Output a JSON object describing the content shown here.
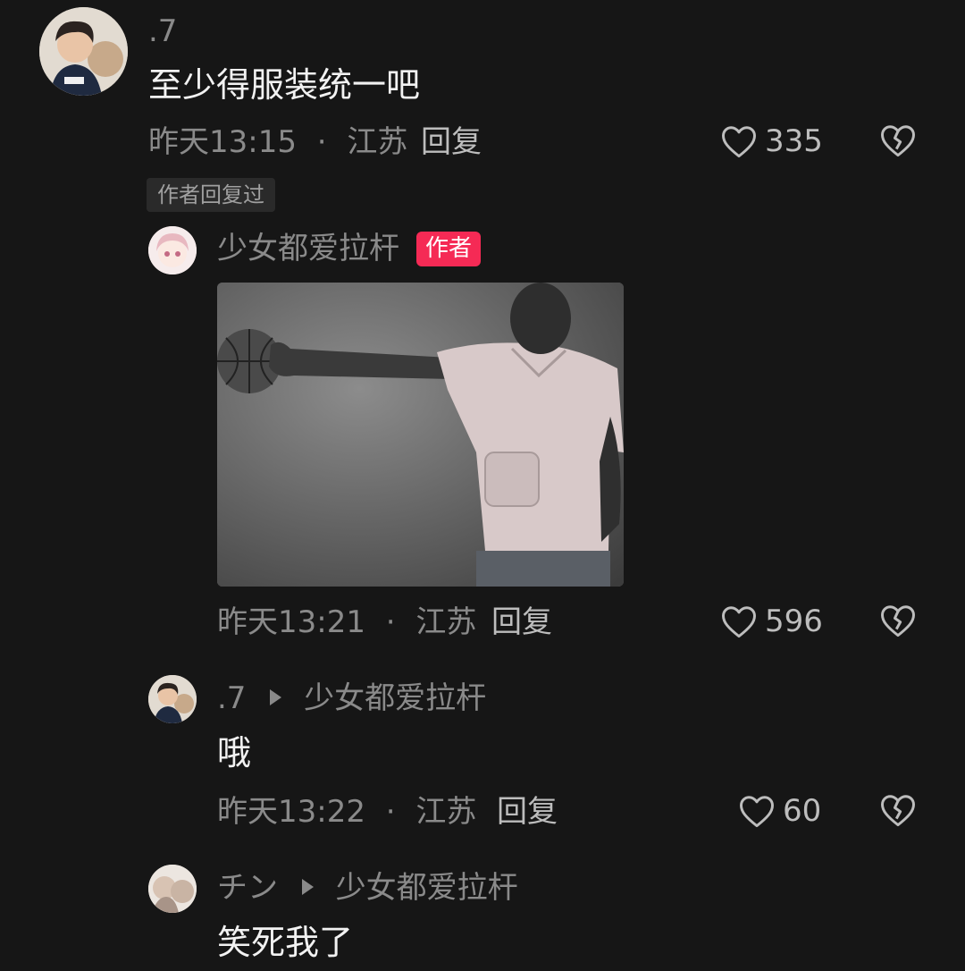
{
  "comments": [
    {
      "username": ".7",
      "text": "至少得服装统一吧",
      "time": "昨天13:15",
      "location": "江苏",
      "reply_label": "回复",
      "likes": "335",
      "author_replied_badge": "作者回复过"
    },
    {
      "username": "少女都爱拉杆",
      "author_badge": "作者",
      "time": "昨天13:21",
      "location": "江苏",
      "reply_label": "回复",
      "likes": "596"
    },
    {
      "username": ".7",
      "reply_to": "少女都爱拉杆",
      "text": "哦",
      "time": "昨天13:22",
      "location": "江苏",
      "reply_label": "回复",
      "likes": "60"
    },
    {
      "username": "チン",
      "reply_to": "少女都爱拉杆",
      "text": "笑死我了"
    }
  ],
  "meta_separator": "·",
  "icons": {
    "like": "heart-outline-icon",
    "dislike": "broken-heart-icon",
    "reply_arrow": "play-triangle-icon"
  },
  "colors": {
    "background": "#161616",
    "author_badge": "#f52a55",
    "secondary_text": "#8a8a8a",
    "primary_text": "#f2f2f2"
  }
}
